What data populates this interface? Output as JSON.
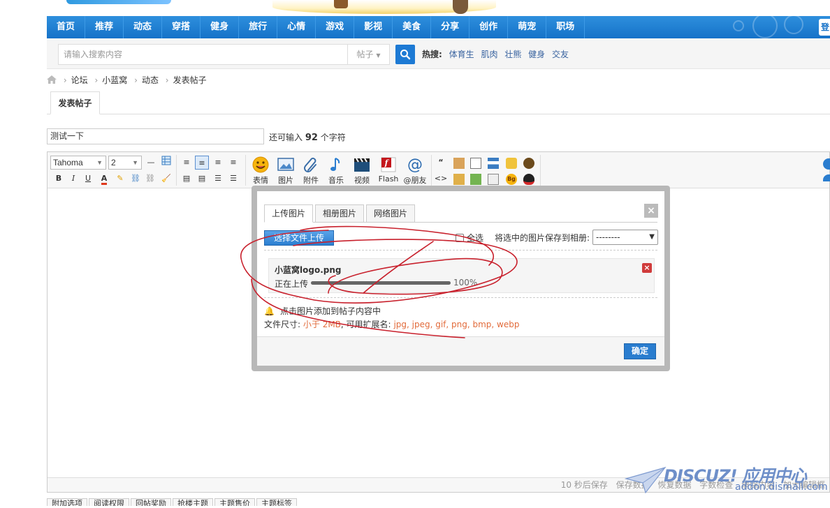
{
  "nav": {
    "items": [
      "首页",
      "推荐",
      "动态",
      "穿搭",
      "健身",
      "旅行",
      "心情",
      "游戏",
      "影视",
      "美食",
      "分享",
      "创作",
      "萌宠",
      "职场"
    ],
    "right_label": "登"
  },
  "search": {
    "placeholder": "请输入搜索内容",
    "type_label": "帖子",
    "hot_label": "热搜:",
    "hot_terms": [
      "体育生",
      "肌肉",
      "壮熊",
      "健身",
      "交友"
    ]
  },
  "breadcrumb": [
    "论坛",
    "小蓝窝",
    "动态",
    "发表帖子"
  ],
  "page_tab": "发表帖子",
  "subject": {
    "value": "测试一下",
    "hint_prefix": "还可输入",
    "remaining": "92",
    "hint_suffix": "个字符"
  },
  "toolbar": {
    "font": "Tahoma",
    "size": "2",
    "big_buttons": [
      "表情",
      "图片",
      "附件",
      "音乐",
      "视频",
      "Flash",
      "@朋友"
    ]
  },
  "statusbar": [
    "10 秒后保存",
    "保存数据",
    "恢复数据",
    "字数检查",
    "清除内容",
    "加大编辑框"
  ],
  "bottom_tabs": [
    "附加选项",
    "阅读权限",
    "回帖奖励",
    "抢楼主题",
    "主题售价",
    "主题标签"
  ],
  "dialog": {
    "tabs": [
      "上传图片",
      "相册图片",
      "网络图片"
    ],
    "close": "×",
    "upload_button": "选择文件上传",
    "select_all": "全选",
    "save_to_album": "将选中的图片保存到相册:",
    "album_value": "--------",
    "file": {
      "name": "小蓝窝logo.png",
      "status": "正在上传",
      "progress": 1.0,
      "progress_text": "100%"
    },
    "tip": "点击图片添加到帖子内容中",
    "size_label": "文件尺寸:",
    "size_value": "小于 2MB",
    "ext_label": ", 可用扩展名:",
    "ext_value": "jpg, jpeg, gif, png, bmp, webp",
    "ok": "确定"
  },
  "watermark": {
    "brand": "DISCUZ! 应用中心",
    "domain": "addon.dismall.com"
  },
  "colors": {
    "nav": "#1572c8",
    "accent": "#2a7dcf",
    "highlight": "#e26b3b",
    "scribble": "#cc1f2a"
  }
}
